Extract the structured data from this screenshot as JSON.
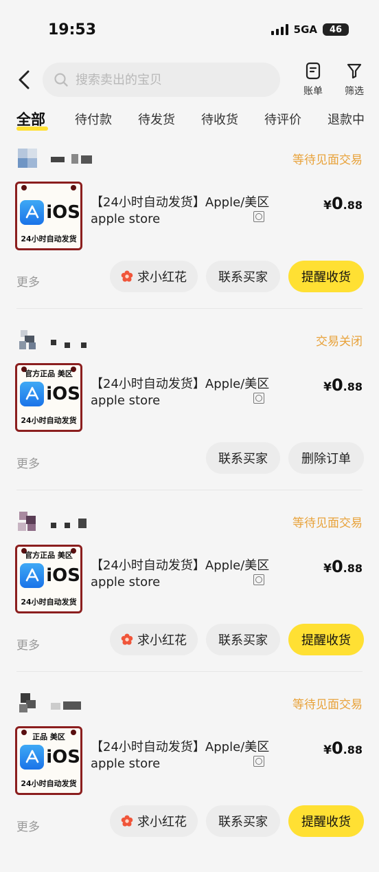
{
  "status_bar": {
    "time": "19:53",
    "network": "5GA",
    "battery": "46"
  },
  "header": {
    "search_placeholder": "搜索卖出的宝贝",
    "bill_label": "账单",
    "filter_label": "筛选"
  },
  "tabs": [
    {
      "label": "全部",
      "active": true
    },
    {
      "label": "待付款"
    },
    {
      "label": "待发货"
    },
    {
      "label": "待收货"
    },
    {
      "label": "待评价"
    },
    {
      "label": "退款中"
    }
  ],
  "colors": {
    "accent": "#ffe033",
    "status": "#e8a23a",
    "thumb_border": "#8b1e1e"
  },
  "orders": [
    {
      "status": "等待见面交易",
      "thumb_top": "",
      "thumb_ios": "iOS",
      "thumb_bottom": "24小时自动发货",
      "title": "【24小时自动发货】Apple/美区",
      "subtitle": "apple store",
      "price_currency": "¥",
      "price_int": "0",
      "price_dec": ".88",
      "more": "更多",
      "buttons": [
        "求小红花",
        "联系买家",
        "提醒收货"
      ]
    },
    {
      "status": "交易关闭",
      "thumb_top": "官方正品 美区",
      "thumb_ios": "iOS",
      "thumb_bottom": "24小时自动发货",
      "title": "【24小时自动发货】Apple/美区",
      "subtitle": "apple store",
      "price_currency": "¥",
      "price_int": "0",
      "price_dec": ".88",
      "more": "更多",
      "buttons": [
        "联系买家",
        "删除订单"
      ]
    },
    {
      "status": "等待见面交易",
      "thumb_top": "官方正品 美区",
      "thumb_ios": "iOS",
      "thumb_bottom": "24小时自动发货",
      "title": "【24小时自动发货】Apple/美区",
      "subtitle": "apple store",
      "price_currency": "¥",
      "price_int": "0",
      "price_dec": ".88",
      "more": "更多",
      "buttons": [
        "求小红花",
        "联系买家",
        "提醒收货"
      ]
    },
    {
      "status": "等待见面交易",
      "thumb_top": "正品 美区",
      "thumb_ios": "iOS",
      "thumb_bottom": "24小时自动发货",
      "title": "【24小时自动发货】Apple/美区",
      "subtitle": "apple store",
      "price_currency": "¥",
      "price_int": "0",
      "price_dec": ".88",
      "more": "更多",
      "buttons": [
        "求小红花",
        "联系买家",
        "提醒收货"
      ]
    }
  ]
}
